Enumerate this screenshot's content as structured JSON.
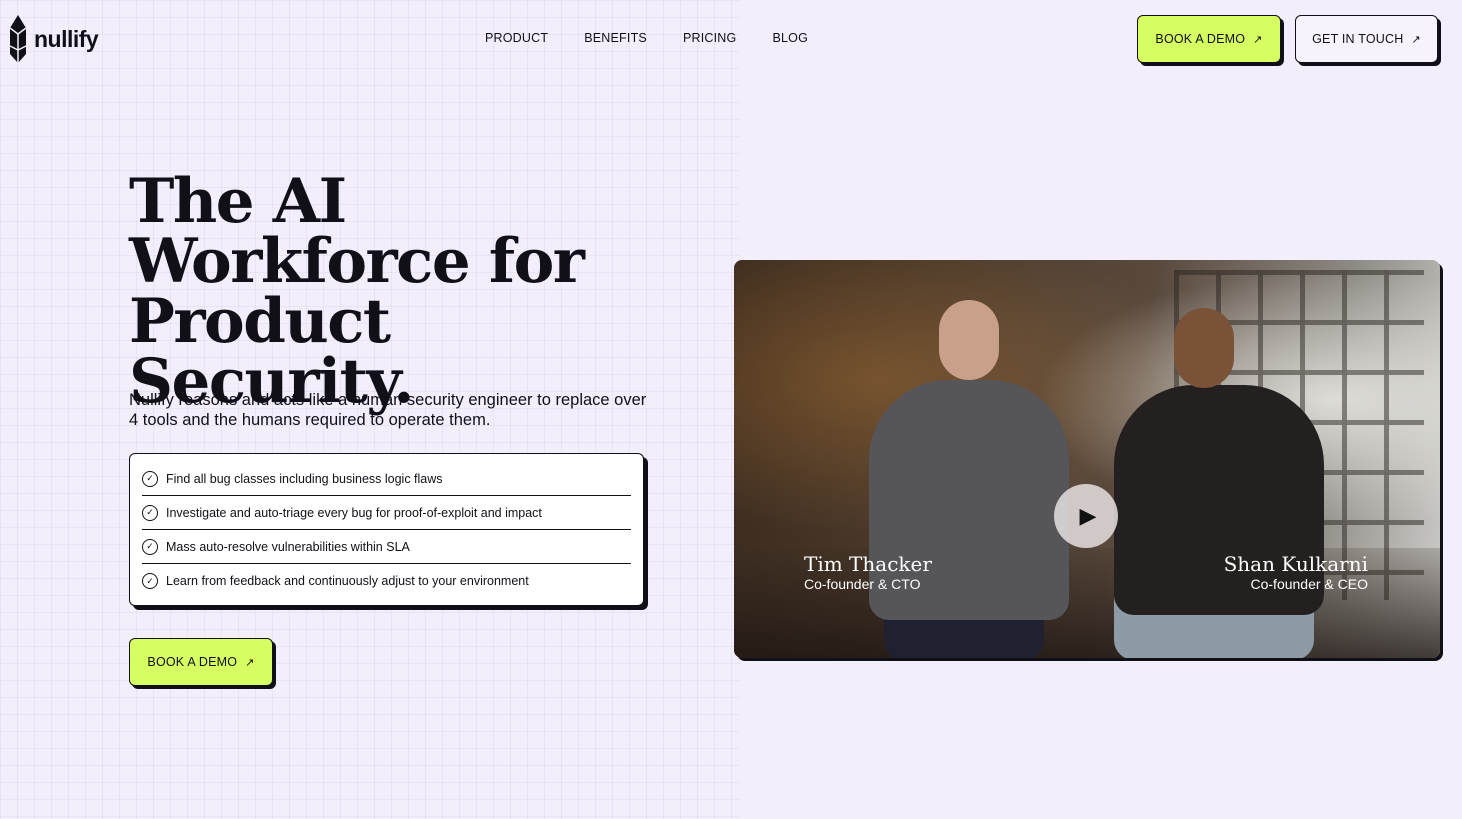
{
  "brand": {
    "name": "nullify"
  },
  "nav": {
    "items": [
      "PRODUCT",
      "BENEFITS",
      "PRICING",
      "BLOG"
    ]
  },
  "header_actions": {
    "book_demo": "BOOK A DEMO",
    "get_in_touch": "GET IN TOUCH"
  },
  "hero": {
    "title_lines": [
      "The AI",
      "Workforce for",
      "Product Security."
    ],
    "subtitle": "Nullify reasons and acts like a human security engineer to replace over 4 tools and the humans required to operate them.",
    "features": [
      "Find all bug classes including business logic flaws",
      "Investigate and auto-triage every bug for proof-of-exploit and impact",
      "Mass auto-resolve vulnerabilities within SLA",
      "Learn from feedback and continuously adjust to your environment"
    ],
    "cta": "BOOK A DEMO"
  },
  "video": {
    "people": [
      {
        "name": "Tim Thacker",
        "role": "Co-founder & CTO"
      },
      {
        "name": "Shan Kulkarni",
        "role": "Co-founder & CEO"
      }
    ]
  },
  "icons": {
    "logo": "crystal-logo-icon",
    "arrow": "arrow-up-right-icon",
    "check": "check-circle-icon",
    "play": "play-icon"
  },
  "colors": {
    "background": "#f2eefb",
    "accent": "#d6fd61",
    "ink": "#111018"
  }
}
